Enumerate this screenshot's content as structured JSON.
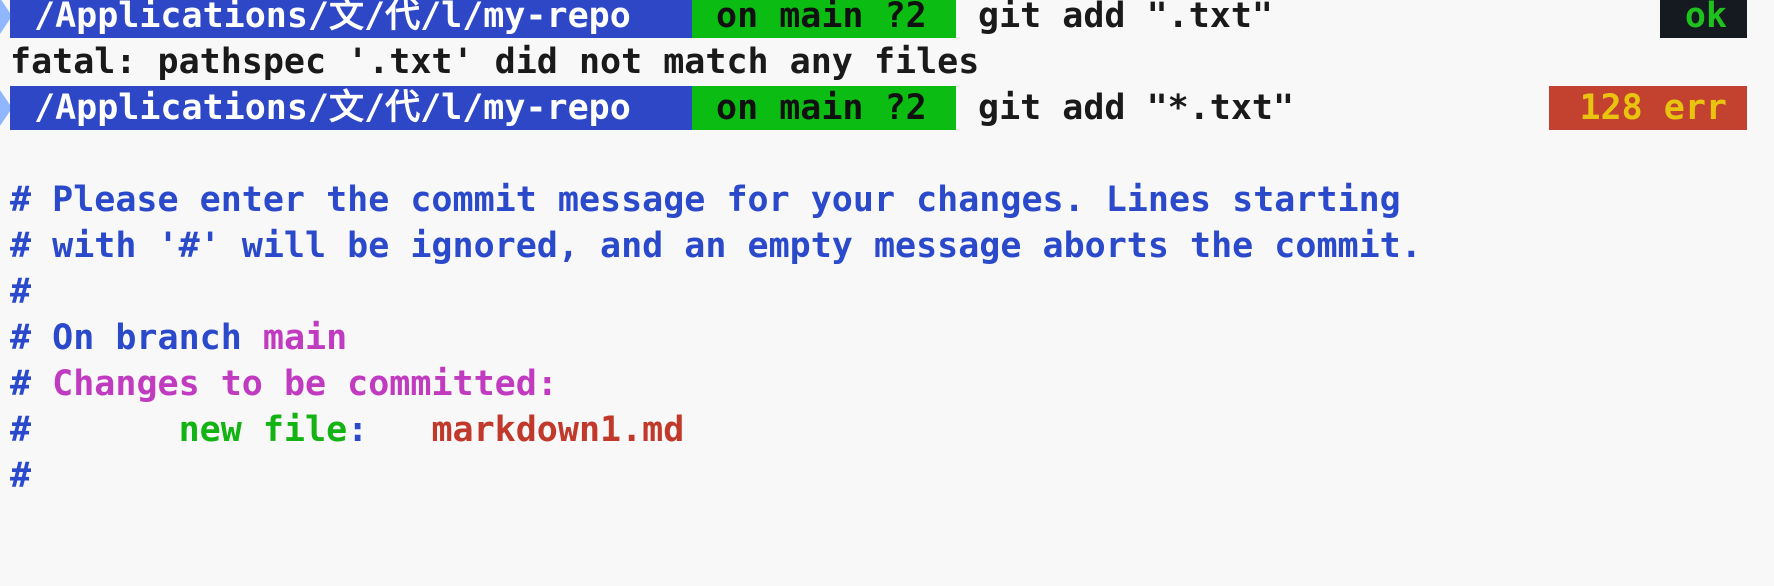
{
  "prompt1": {
    "path": "/Applications/文/代/l/my-repo",
    "git": "on main ?2",
    "command": "git add \".txt\"",
    "status": "ok"
  },
  "output1": "fatal: pathspec '.txt' did not match any files",
  "prompt2": {
    "path": "/Applications/文/代/l/my-repo",
    "git": "on main ?2",
    "command": "git add \"*.txt\"",
    "status": "128 err"
  },
  "commit_template": {
    "line1": "# Please enter the commit message for your changes. Lines starting",
    "line2": "# with '#' will be ignored, and an empty message aborts the commit.",
    "line3": "#",
    "branch_prefix": "# On branch ",
    "branch_name": "main",
    "changes_hash": "# ",
    "changes_label": "Changes to be committed:",
    "file_hash": "#       ",
    "file_kind": "new file",
    "file_colon": ":   ",
    "file_name": "markdown1.md",
    "line7": "#"
  },
  "colors": {
    "path_bg": "#2d47c7",
    "git_bg": "#0bbd12",
    "ok_bg": "#141a1f",
    "ok_fg": "#1fc11f",
    "err_bg": "#c2412f",
    "err_fg": "#e8c40f",
    "comment": "#2b4acb",
    "magenta": "#c13bc1"
  }
}
